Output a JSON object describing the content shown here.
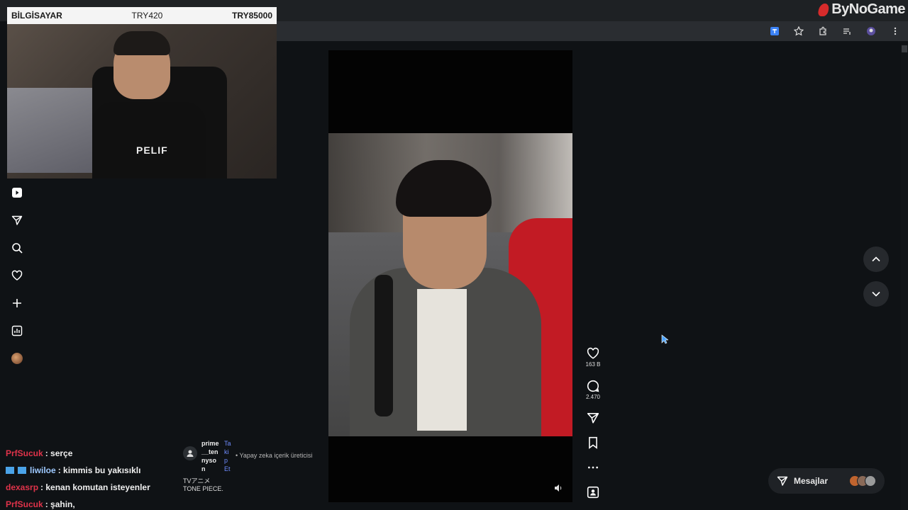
{
  "overlay": {
    "title": "BİLGİSAYAR",
    "middle": "TRY420",
    "right": "TRY85000"
  },
  "brand": {
    "name": "ByNoGame",
    "accent": "#d62b2b"
  },
  "cam": {
    "shirt_text": "PELIF"
  },
  "sidebar": {
    "items": [
      {
        "icon": "play-icon"
      },
      {
        "icon": "send-icon"
      },
      {
        "icon": "search-icon"
      },
      {
        "icon": "heart-icon"
      },
      {
        "icon": "plus-icon"
      },
      {
        "icon": "chart-icon"
      },
      {
        "icon": "avatar"
      }
    ]
  },
  "chat": {
    "lines": [
      {
        "user": "PrfSucuk",
        "message": ": serçe"
      },
      {
        "user": "liwiloe",
        "message": ": kimmis bu yakısıklı"
      },
      {
        "user": "dexasrp",
        "message": ": kenan komutan isteyenler"
      },
      {
        "user": "PrfSucuk",
        "message": ": şahin,"
      }
    ]
  },
  "caption": {
    "username": "prime__tennyson",
    "follow": "Takip Et",
    "ai_label": "• Yapay zeka içerik üreticisi",
    "text_line1": "TVアニメ",
    "text_line2": "TONE PIECE."
  },
  "actions": {
    "likes": "163 B",
    "comments": "2.470"
  },
  "messages": {
    "label": "Mesajlar"
  }
}
